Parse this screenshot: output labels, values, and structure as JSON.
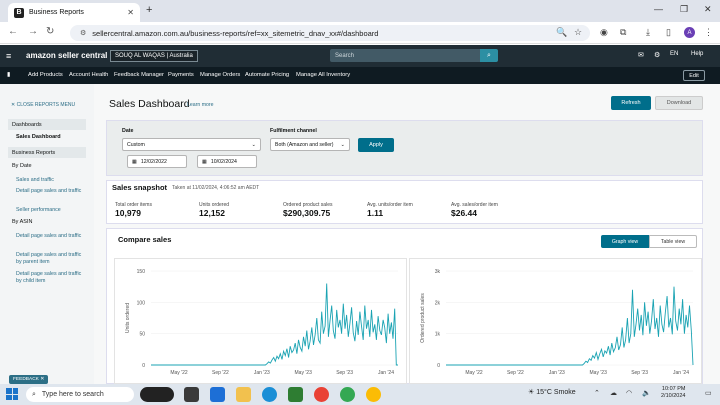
{
  "browser": {
    "tab_title": "Business Reports",
    "tab_favicon": "B",
    "url": "sellercentral.amazon.com.au/business-reports/ref=xx_sitemetric_dnav_xx#/dashboard",
    "profile_initial": "A"
  },
  "header": {
    "logo": "amazon seller central",
    "store": "SOUQ AL WAQAS | Australia",
    "search_placeholder": "Search",
    "language": "EN",
    "help": "Help"
  },
  "nav": {
    "items": [
      "Add Products",
      "Account Health",
      "Feedback Manager",
      "Payments",
      "Manage Orders",
      "Automate Pricing",
      "Manage All Inventory"
    ],
    "edit": "Edit"
  },
  "sidebar": {
    "close": "CLOSE REPORTS MENU",
    "dashboards": "Dashboards",
    "sales_dashboard": "Sales Dashboard",
    "business_reports": "Business Reports",
    "by_date": "By Date",
    "date_links": [
      "Sales and traffic",
      "Detail page sales and traffic",
      "Seller performance"
    ],
    "by_asin": "By ASIN",
    "asin_links": [
      "Detail page sales and traffic",
      "Detail page sales and traffic by parent item",
      "Detail page sales and traffic by child item"
    ],
    "feedback": "FEEDBACK"
  },
  "page": {
    "title": "Sales Dashboard",
    "learn_more": "Learn more",
    "refresh": "Refresh",
    "download": "Download"
  },
  "filters": {
    "date_label": "Date",
    "date_value": "Custom",
    "from_date": "12/02/2022",
    "to_date": "10/02/2024",
    "fulfilment_label": "Fulfilment channel",
    "fulfilment_value": "Both (Amazon and seller)",
    "apply": "Apply"
  },
  "snapshot": {
    "title": "Sales snapshot",
    "taken": "Taken at 11/02/2024, 4:06:52 am AEDT",
    "metrics": [
      {
        "label": "Total order items",
        "value": "10,979"
      },
      {
        "label": "Units ordered",
        "value": "12,152"
      },
      {
        "label": "Ordered product sales",
        "value": "$290,309.75"
      },
      {
        "label": "Avg. units/order item",
        "value": "1.11"
      },
      {
        "label": "Avg. sales/order item",
        "value": "$26.44"
      }
    ]
  },
  "compare": {
    "title": "Compare sales",
    "graph_view": "Graph view",
    "table_view": "Table view"
  },
  "chart_data": [
    {
      "type": "line",
      "ylabel": "Units ordered",
      "yticks": [
        "150",
        "100",
        "50",
        "0"
      ],
      "ylim": [
        0,
        150
      ],
      "xticks": [
        "May '22",
        "Sep '22",
        "Jan '23",
        "May '23",
        "Sep '23",
        "Jan '24"
      ],
      "color": "#1aa3b3",
      "values": [
        0,
        0,
        0,
        0,
        0,
        0,
        0,
        0,
        0,
        0,
        0,
        0,
        0,
        0,
        0,
        0,
        0,
        0,
        0,
        0,
        0,
        0,
        0,
        0,
        0,
        0,
        0,
        0,
        0,
        0,
        0,
        0,
        0,
        0,
        0,
        0,
        0,
        0,
        0,
        0,
        0,
        0,
        0,
        0,
        0,
        0,
        0,
        0,
        0,
        0,
        0,
        0,
        0,
        0,
        0,
        0,
        0,
        0,
        0,
        0,
        0,
        0,
        0,
        0,
        0,
        0,
        0,
        0,
        0,
        0,
        2,
        5,
        3,
        8,
        12,
        6,
        14,
        10,
        18,
        9,
        22,
        15,
        26,
        12,
        30,
        20,
        24,
        35,
        18,
        40,
        28,
        22,
        45,
        30,
        55,
        25,
        38,
        60,
        32,
        48,
        75,
        40,
        35,
        85,
        50,
        62,
        130,
        45,
        70,
        95,
        55,
        42,
        88,
        60,
        72,
        50,
        98,
        58,
        80,
        45,
        66,
        92,
        52,
        38,
        70,
        48,
        85,
        62,
        40,
        95,
        58,
        72,
        45,
        88,
        52,
        65,
        40,
        78,
        55,
        48,
        72,
        60,
        35,
        82,
        50,
        68,
        42,
        90,
        0,
        0
      ]
    },
    {
      "type": "line",
      "ylabel": "Ordered product sales",
      "yticks": [
        "3k",
        "2k",
        "1k",
        "0"
      ],
      "ylim": [
        0,
        3000
      ],
      "xticks": [
        "May '22",
        "Sep '22",
        "Jan '23",
        "May '23",
        "Sep '23",
        "Jan '24"
      ],
      "color": "#1aa3b3",
      "values": [
        0,
        0,
        0,
        0,
        0,
        0,
        0,
        0,
        0,
        0,
        0,
        0,
        0,
        0,
        0,
        0,
        0,
        0,
        0,
        0,
        0,
        0,
        0,
        0,
        0,
        0,
        0,
        0,
        0,
        0,
        0,
        0,
        0,
        0,
        0,
        0,
        0,
        0,
        0,
        0,
        0,
        0,
        0,
        0,
        0,
        0,
        0,
        0,
        0,
        0,
        0,
        0,
        0,
        0,
        0,
        0,
        0,
        0,
        0,
        0,
        0,
        0,
        0,
        0,
        0,
        0,
        0,
        0,
        0,
        0,
        0,
        0,
        0,
        0,
        0,
        0,
        0,
        0,
        0,
        0,
        50,
        120,
        80,
        200,
        150,
        300,
        220,
        400,
        180,
        350,
        500,
        260,
        450,
        380,
        600,
        320,
        700,
        420,
        550,
        900,
        480,
        650,
        1200,
        560,
        800,
        1500,
        700,
        1000,
        2400,
        900,
        1300,
        1800,
        1100,
        1600,
        950,
        2000,
        1250,
        1700,
        1000,
        1400,
        2100,
        1150,
        1500,
        900,
        1900,
        1300,
        1050,
        1700,
        2200,
        1200,
        1500,
        980,
        2500,
        1400,
        1100,
        1800,
        1300,
        2100,
        1000,
        1600,
        1200,
        1900,
        1100,
        0
      ]
    }
  ],
  "taskbar": {
    "search": "Type here to search",
    "weather": "15°C  Smoke",
    "time": "10:07 PM",
    "date": "2/10/2024"
  }
}
